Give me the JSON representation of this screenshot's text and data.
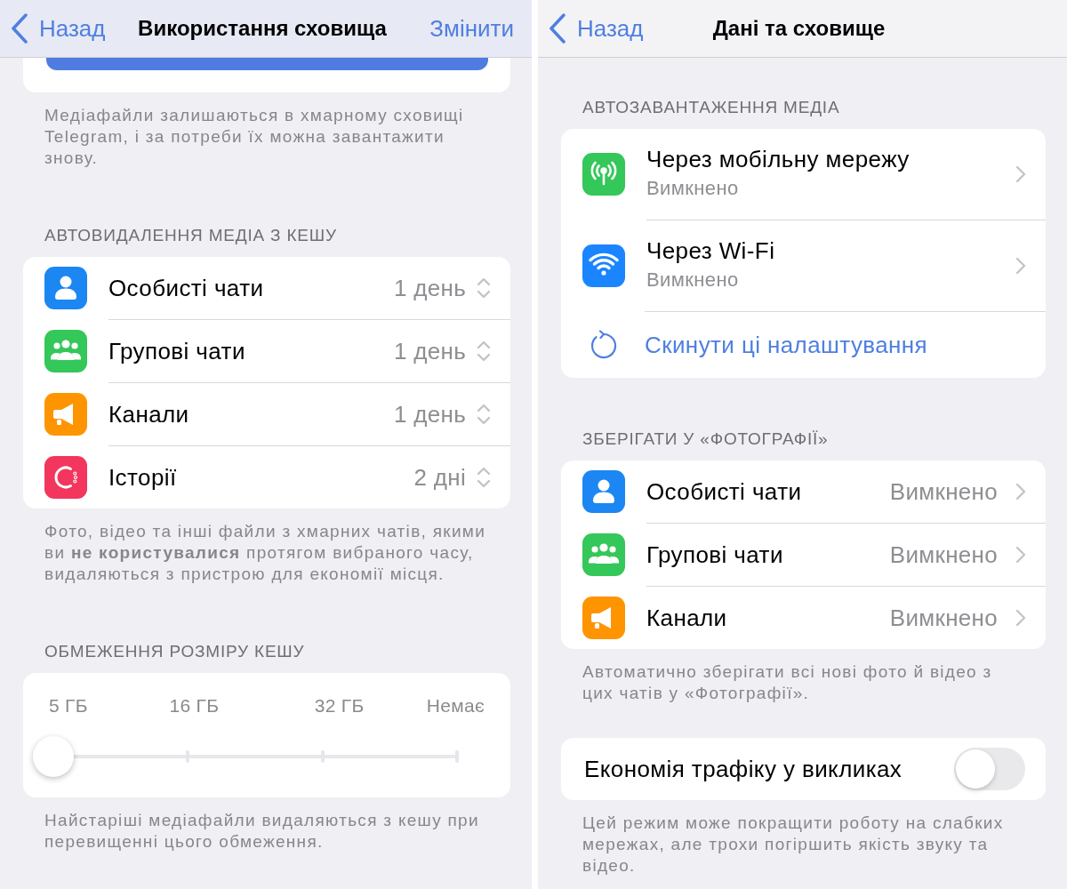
{
  "screens": [
    {
      "nav": {
        "back": "Назад",
        "title": "Використання сховища",
        "action": "Змінити"
      },
      "sections": [
        {
          "kind": "clipped-button",
          "footer": "Медіафайли залишаються в хмарному сховищі Telegram, і за потреби їх можна завантажити знову."
        },
        {
          "kind": "list",
          "header": "АВТОВИДАЛЕННЯ МЕДІА З КЕШУ",
          "rows": [
            {
              "kind": "picker",
              "label": "Особисті чати",
              "value": "1 день",
              "color": "#1c86f2"
            },
            {
              "kind": "picker",
              "label": "Групові чати",
              "value": "1 день",
              "color": "#34c759"
            },
            {
              "kind": "picker",
              "label": "Канали",
              "value": "1 день",
              "color": "#fe9500"
            },
            {
              "kind": "picker",
              "label": "Історії",
              "value": "2 дні",
              "color": "#f2365d"
            }
          ],
          "footer": "Фото, відео та інші файли з хмарних чатів, якими ви **не користувалися** протягом вибраного часу, видаляються з пристрою для економії місця."
        },
        {
          "kind": "slider",
          "header": "ОБМЕЖЕННЯ РОЗМІРУ КЕШУ",
          "stops": [
            "5 ГБ",
            "16 ГБ",
            "32 ГБ",
            "Немає"
          ],
          "level": 0,
          "footer": "Найстаріші медіафайли видаляються з кешу при перевищенні цього обмеження."
        }
      ]
    },
    {
      "nav": {
        "back": "Назад",
        "title": "Дані та сховище"
      },
      "sections": [
        {
          "kind": "list",
          "header": "АВТОЗАВАНТАЖЕННЯ МЕДІА",
          "rows": [
            {
              "kind": "link",
              "label": "Через мобільну мережу",
              "subtitle": "Вимкнено",
              "color": "#34c759"
            },
            {
              "kind": "link",
              "label": "Через Wi-Fi",
              "subtitle": "Вимкнено",
              "color": "#1a85ff"
            },
            {
              "kind": "action",
              "label": "Скинути ці налаштування"
            }
          ]
        },
        {
          "kind": "list",
          "header": "ЗБЕРІГАТИ У «ФОТОГРАФІЇ»",
          "rows": [
            {
              "kind": "value",
              "label": "Особисті чати",
              "value": "Вимкнено",
              "color": "#1c86f2"
            },
            {
              "kind": "value",
              "label": "Групові чати",
              "value": "Вимкнено",
              "color": "#34c759"
            },
            {
              "kind": "value",
              "label": "Канали",
              "value": "Вимкнено",
              "color": "#fe9500"
            }
          ],
          "footer": "Автоматично зберігати всі нові фото й відео з цих чатів у «Фотографії»."
        },
        {
          "kind": "list",
          "rows": [
            {
              "kind": "toggle",
              "label": "Економія трафіку у викликах",
              "on": false
            }
          ],
          "footer": "Цей режим може покращити роботу на слабких мережах, але трохи погіршить якість звуку та відео."
        }
      ]
    }
  ]
}
